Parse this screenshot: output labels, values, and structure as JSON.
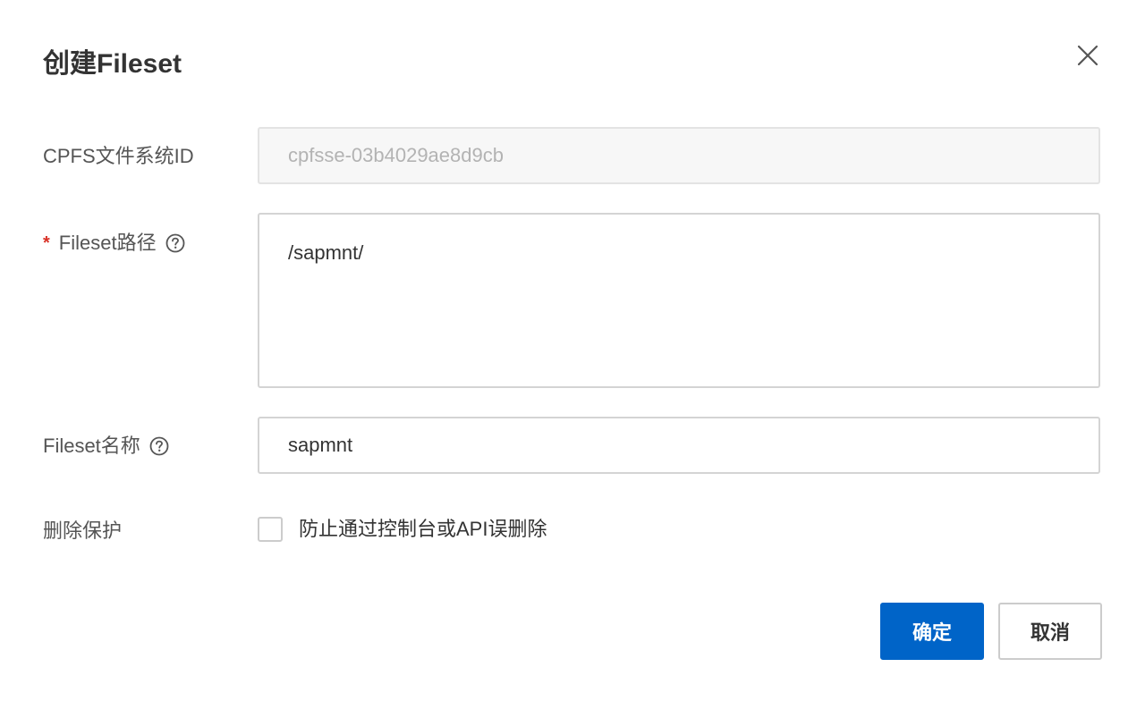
{
  "dialog": {
    "title": "创建Fileset"
  },
  "form": {
    "cpfs_id": {
      "label": "CPFS文件系统ID",
      "value": "cpfsse-03b4029ae8d9cb"
    },
    "fileset_path": {
      "required_mark": "*",
      "label": "Fileset路径",
      "value": "/sapmnt/"
    },
    "fileset_name": {
      "label": "Fileset名称",
      "value": "sapmnt"
    },
    "delete_protection": {
      "label": "删除保护",
      "checkbox_label": "防止通过控制台或API误删除",
      "checked": false
    }
  },
  "footer": {
    "confirm_label": "确定",
    "cancel_label": "取消"
  },
  "colors": {
    "primary": "#0064c8",
    "required": "#d93026"
  },
  "icons": {
    "close": "close-icon",
    "help": "question-circle-icon"
  }
}
